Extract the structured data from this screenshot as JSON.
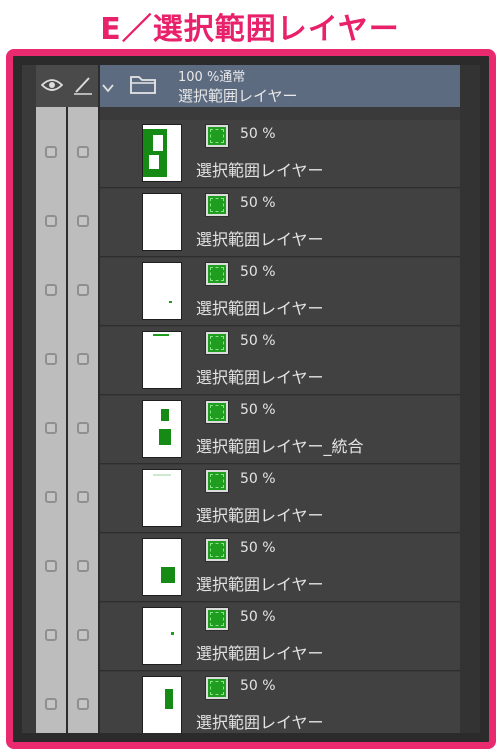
{
  "page_title": "E／選択範囲レイヤー",
  "folder": {
    "mode": "100 %通常",
    "name": "選択範囲レイヤー"
  },
  "layers": [
    {
      "opacity": "50 %",
      "name": "選択範囲レイヤー"
    },
    {
      "opacity": "50 %",
      "name": "選択範囲レイヤー"
    },
    {
      "opacity": "50 %",
      "name": "選択範囲レイヤー"
    },
    {
      "opacity": "50 %",
      "name": "選択範囲レイヤー"
    },
    {
      "opacity": "50 %",
      "name": "選択範囲レイヤー_統合"
    },
    {
      "opacity": "50 %",
      "name": "選択範囲レイヤー"
    },
    {
      "opacity": "50 %",
      "name": "選択範囲レイヤー"
    },
    {
      "opacity": "50 %",
      "name": "選択範囲レイヤー"
    },
    {
      "opacity": "50 %",
      "name": "選択範囲レイヤー"
    }
  ],
  "colors": {
    "accent": "#ea2a6f",
    "selection_green": "#1f9d1f",
    "folder_row": "#5c6b80"
  },
  "icons": [
    "eye-icon",
    "pen-icon",
    "chevron-down-icon",
    "folder-icon",
    "selection-color-icon",
    "checkbox-icon"
  ]
}
